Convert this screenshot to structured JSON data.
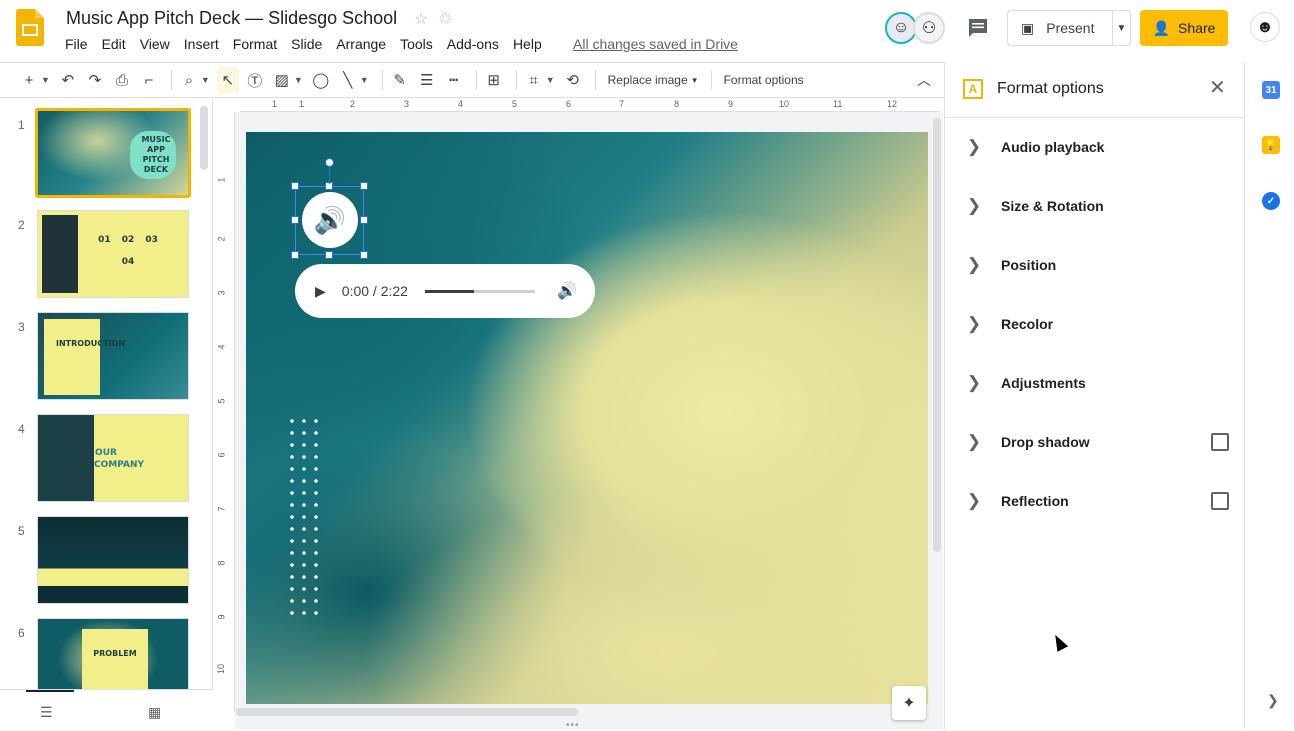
{
  "app": {
    "doc_title": "Music App Pitch Deck — Slidesgo School",
    "saved_status": "All changes saved in Drive",
    "brand_color": "#f4b400"
  },
  "menu": [
    "File",
    "Edit",
    "View",
    "Insert",
    "Format",
    "Slide",
    "Arrange",
    "Tools",
    "Add-ons",
    "Help"
  ],
  "header": {
    "present_label": "Present",
    "share_label": "Share",
    "share_color": "#fbbc04"
  },
  "toolbar": {
    "replace_image_label": "Replace image",
    "format_options_label": "Format options"
  },
  "filmstrip": {
    "slides": [
      {
        "num": "1",
        "label": "MUSIC APP PITCH DECK",
        "selected": true
      },
      {
        "num": "2",
        "label": "01 02 03 04"
      },
      {
        "num": "3",
        "label": "INTRODUCTION"
      },
      {
        "num": "4",
        "label": "OUR COMPANY"
      },
      {
        "num": "5",
        "label": ""
      },
      {
        "num": "6",
        "label": "PROBLEM"
      }
    ]
  },
  "ruler": {
    "top": [
      "1",
      "1",
      "2",
      "3",
      "4",
      "5",
      "6",
      "7",
      "8",
      "9",
      "10",
      "11",
      "12"
    ],
    "left": [
      "1",
      "2",
      "3",
      "4",
      "5",
      "6",
      "7",
      "8",
      "9",
      "10"
    ]
  },
  "audio_player": {
    "time": "0:00 / 2:22",
    "progress": 0.45
  },
  "format_panel": {
    "title": "Format options",
    "sections": [
      {
        "label": "Audio playback",
        "checkbox": false
      },
      {
        "label": "Size & Rotation",
        "checkbox": false
      },
      {
        "label": "Position",
        "checkbox": false
      },
      {
        "label": "Recolor",
        "checkbox": false
      },
      {
        "label": "Adjustments",
        "checkbox": false
      },
      {
        "label": "Drop shadow",
        "checkbox": true
      },
      {
        "label": "Reflection",
        "checkbox": true
      }
    ]
  },
  "side_strip": {
    "calendar_label": "31"
  },
  "icons": {
    "slides_logo": "slides-logo-icon",
    "star": "star-icon",
    "drive": "drive-icon",
    "comment": "comment-icon",
    "speaker": "speaker-icon"
  }
}
